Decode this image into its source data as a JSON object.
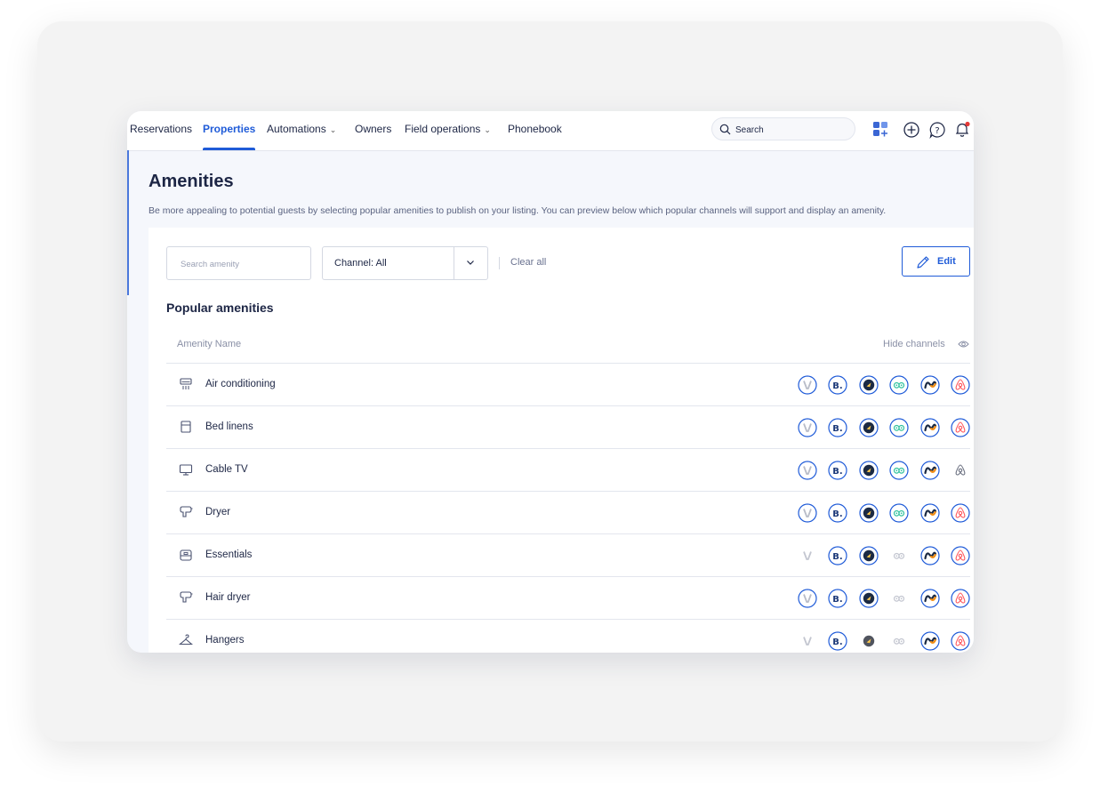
{
  "nav": {
    "items": [
      {
        "label": "Reservations",
        "active": false,
        "dropdown": false
      },
      {
        "label": "Properties",
        "active": true,
        "dropdown": false
      },
      {
        "label": "Automations",
        "active": false,
        "dropdown": true
      },
      {
        "label": "Owners",
        "active": false,
        "dropdown": false
      },
      {
        "label": "Field operations",
        "active": false,
        "dropdown": true
      },
      {
        "label": "Phonebook",
        "active": false,
        "dropdown": false
      }
    ],
    "search_placeholder": "Search",
    "icons": [
      "apps-add-icon",
      "plus-circle-icon",
      "help-icon",
      "bell-icon"
    ]
  },
  "page": {
    "title": "Amenities",
    "description": "Be more appealing to potential guests by selecting popular amenities to publish on your listing. You can preview below which popular channels will support and display an amenity."
  },
  "filters": {
    "search_placeholder": "Search amenity",
    "channel_label": "Channel: All",
    "clear_all": "Clear all",
    "edit_label": "Edit"
  },
  "section": {
    "title": "Popular amenities",
    "column_amenity": "Amenity Name",
    "hide_channels": "Hide channels"
  },
  "channels": [
    "vrbo",
    "booking",
    "expedia",
    "tripadvisor",
    "homeaway",
    "airbnb"
  ],
  "colors": {
    "accent": "#1f5bd8",
    "text": "#1d2645",
    "muted": "#8a90a6"
  },
  "amenities": [
    {
      "name": "Air conditioning",
      "icon": "ac-icon",
      "support": [
        true,
        true,
        true,
        true,
        true,
        true
      ]
    },
    {
      "name": "Bed linens",
      "icon": "linens-icon",
      "support": [
        true,
        true,
        true,
        true,
        true,
        true
      ]
    },
    {
      "name": "Cable TV",
      "icon": "tv-icon",
      "support": [
        true,
        true,
        true,
        true,
        true,
        false
      ]
    },
    {
      "name": "Dryer",
      "icon": "dryer-icon",
      "support": [
        true,
        true,
        true,
        true,
        true,
        true
      ]
    },
    {
      "name": "Essentials",
      "icon": "essentials-icon",
      "support": [
        false,
        true,
        true,
        false,
        true,
        true
      ]
    },
    {
      "name": "Hair dryer",
      "icon": "hair-dryer-icon",
      "support": [
        true,
        true,
        true,
        false,
        true,
        true
      ]
    },
    {
      "name": "Hangers",
      "icon": "hanger-icon",
      "support": [
        false,
        true,
        false,
        false,
        true,
        true
      ]
    }
  ]
}
